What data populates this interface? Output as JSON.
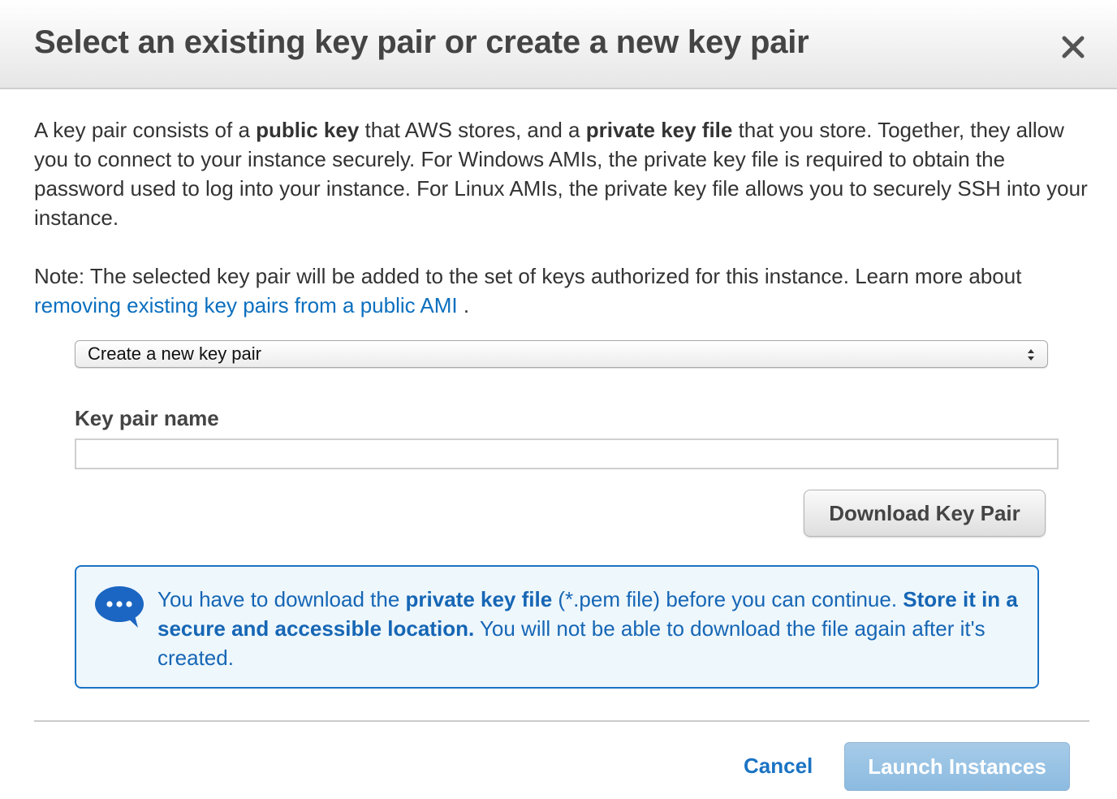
{
  "dialog": {
    "title": "Select an existing key pair or create a new key pair",
    "close_icon": "close-icon"
  },
  "intro": {
    "t1": "A key pair consists of a ",
    "b1": "public key",
    "t2": " that AWS stores, and a ",
    "b2": "private key file",
    "t3": " that you store. Together, they allow you to connect to your instance securely. For Windows AMIs, the private key file is required to obtain the password used to log into your instance. For Linux AMIs, the private key file allows you to securely SSH into your instance."
  },
  "note": {
    "text": "Note: The selected key pair will be added to the set of keys authorized for this instance. Learn more about ",
    "link": "removing existing key pairs from a public AMI",
    "suffix": " ."
  },
  "key_pair_select": {
    "selected": "Create a new key pair"
  },
  "key_pair_name": {
    "label": "Key pair name",
    "value": "",
    "placeholder": ""
  },
  "download_button": {
    "label": "Download Key Pair"
  },
  "info": {
    "icon": "chat-bubble-icon",
    "t1": "You have to download the ",
    "b1": "private key file",
    "t2": " (*.pem file) before you can continue. ",
    "b2": "Store it in a secure and accessible location.",
    "t3": " You will not be able to download the file again after it's created."
  },
  "footer": {
    "cancel": "Cancel",
    "launch": "Launch Instances",
    "launch_disabled": true
  },
  "colors": {
    "link": "#0b6fbf",
    "info_border": "#1a73c4",
    "info_bg": "#eef7fc",
    "info_text": "#1666b5",
    "launch_bg": "#9cc4e4"
  }
}
